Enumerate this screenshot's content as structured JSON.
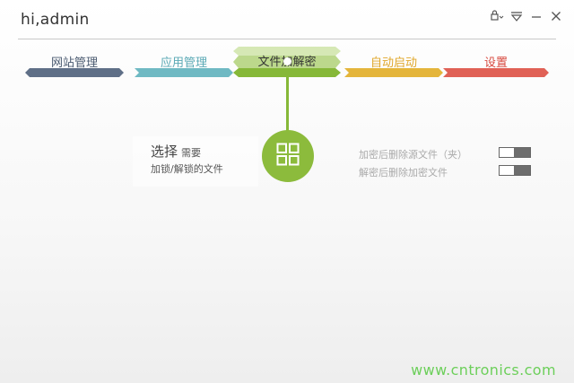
{
  "window": {
    "title": "hi,admin"
  },
  "steps": [
    {
      "label": "网站管理",
      "color": "#5f6f87",
      "text_color": "#4a5a70"
    },
    {
      "label": "应用管理",
      "color": "#6fb9c3",
      "text_color": "#5aa9b5"
    },
    {
      "label": "文件加解密",
      "color": "#86b838",
      "text_color": "#333333",
      "active": true
    },
    {
      "label": "自动启动",
      "color": "#e4b53b",
      "text_color": "#e0a72a"
    },
    {
      "label": "设置",
      "color": "#e06156",
      "text_color": "#d8493f"
    }
  ],
  "encrypt": {
    "select_label": "选择",
    "select_small": "需要",
    "select_sub": "加锁/解锁的文件",
    "icon": "grid-icon"
  },
  "options": [
    {
      "label": "加密后删除源文件（夹）",
      "enabled": true
    },
    {
      "label": "解密后删除加密文件",
      "enabled": true
    }
  ],
  "watermark": "www.cntronics.com",
  "colors": {
    "accent": "#8cbb3c",
    "toggle_knob": "#6d6d6d"
  }
}
